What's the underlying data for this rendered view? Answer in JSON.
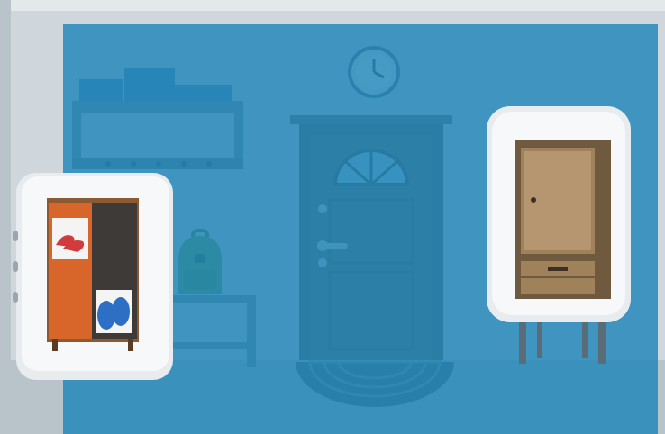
{
  "scene": {
    "type": "room-escape hallway",
    "overlay_color": "#1f86b8",
    "wall_color": "#cfd7dc",
    "floor_color": "#b8c4ca"
  },
  "objects": [
    {
      "name": "wall-clock",
      "icon": "clock-icon"
    },
    {
      "name": "hat-shelf",
      "icon": "shelf-icon"
    },
    {
      "name": "front-door",
      "icon": "door-icon"
    },
    {
      "name": "backpack",
      "icon": "backpack-icon"
    },
    {
      "name": "doormat",
      "icon": "round-rug-icon"
    }
  ],
  "cards": [
    {
      "name": "shoe-cabinet-card",
      "icon": "cabinet-with-shoes-icon",
      "colors": {
        "door": "#d8662a",
        "shoes_red": "#d23b3b",
        "shoes_blue": "#2d6fc4"
      }
    },
    {
      "name": "wardrobe-card",
      "icon": "wardrobe-icon",
      "colors": {
        "wood": "#a0825a"
      }
    }
  ]
}
